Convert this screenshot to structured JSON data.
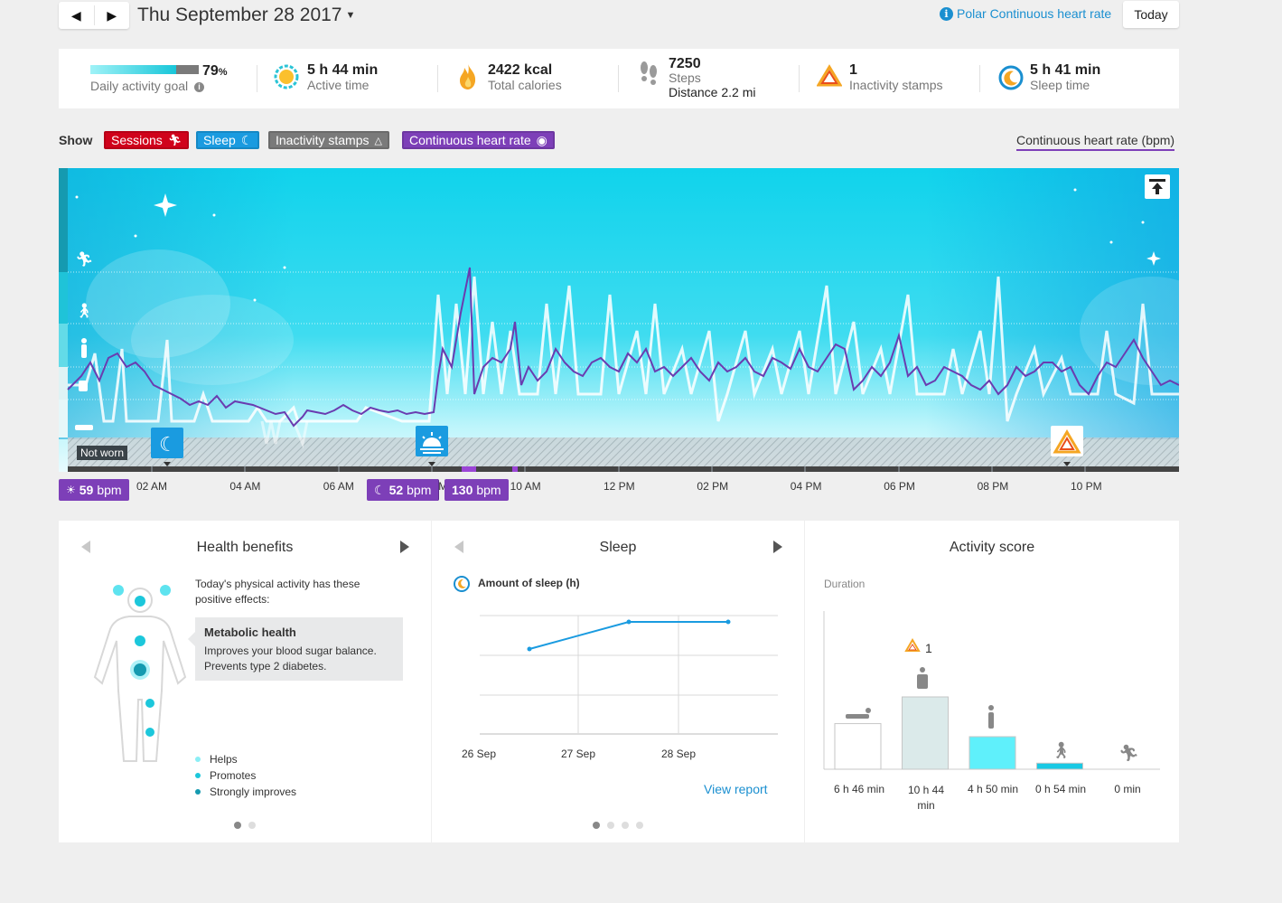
{
  "nav": {
    "prev_glyph": "◀",
    "next_glyph": "▶",
    "date_title": "Thu September 28 2017",
    "polar_link": "Polar Continuous heart rate",
    "today_label": "Today"
  },
  "summary": {
    "goal_percent_value": 79,
    "goal_percent_num": "79",
    "goal_percent_sym": "%",
    "goal_label": "Daily activity goal",
    "active_value": "5 h 44 min",
    "active_label": "Active time",
    "calories_value": "2422 kcal",
    "calories_label": "Total calories",
    "steps_value": "7250",
    "steps_label": "Steps",
    "distance_label": "Distance 2.2 mi",
    "inactivity_value": "1",
    "inactivity_label": "Inactivity stamps",
    "sleep_value": "5 h 41 min",
    "sleep_label": "Sleep time"
  },
  "show": {
    "label": "Show",
    "sessions": "Sessions",
    "sleep": "Sleep",
    "inactivity": "Inactivity stamps",
    "hr": "Continuous heart rate",
    "hr_axis_label": "Continuous heart rate (bpm)"
  },
  "chart": {
    "not_worn": "Not worn",
    "time_labels": [
      "02 AM",
      "04 AM",
      "06 AM",
      "08 AM",
      "10 AM",
      "12 PM",
      "02 PM",
      "04 PM",
      "06 PM",
      "08 PM",
      "10 PM"
    ],
    "badge_low_day_value": "59",
    "badge_sleep_value": "52",
    "badge_high_value": "130",
    "bpm_unit": "bpm"
  },
  "health": {
    "title": "Health benefits",
    "intro": "Today's physical activity has these positive effects:",
    "box_title": "Metabolic health",
    "box_text": "Improves your blood sugar balance. Prevents type 2 diabetes.",
    "legend": [
      "Helps",
      "Promotes",
      "Strongly improves"
    ]
  },
  "sleep_card": {
    "title": "Sleep",
    "subtitle": "Amount of sleep (h)",
    "x_labels": [
      "26 Sep",
      "27 Sep",
      "28 Sep"
    ],
    "view_report": "View report"
  },
  "activity": {
    "title": "Activity score",
    "duration_label": "Duration",
    "inactivity_count": "1",
    "bars": [
      {
        "label": "6 h 46 min",
        "minutes": 406
      },
      {
        "label": "10 h 44 min",
        "minutes": 644
      },
      {
        "label": "4 h 50 min",
        "minutes": 290
      },
      {
        "label": "0 h 54 min",
        "minutes": 54
      },
      {
        "label": "0 min",
        "minutes": 0
      }
    ]
  },
  "colors": {
    "sessions": "#d0021b",
    "sleep": "#1a9be0",
    "inactivity": "#7a7a7a",
    "hr": "#7d3fb8",
    "accent": "#1a8fd0"
  }
}
